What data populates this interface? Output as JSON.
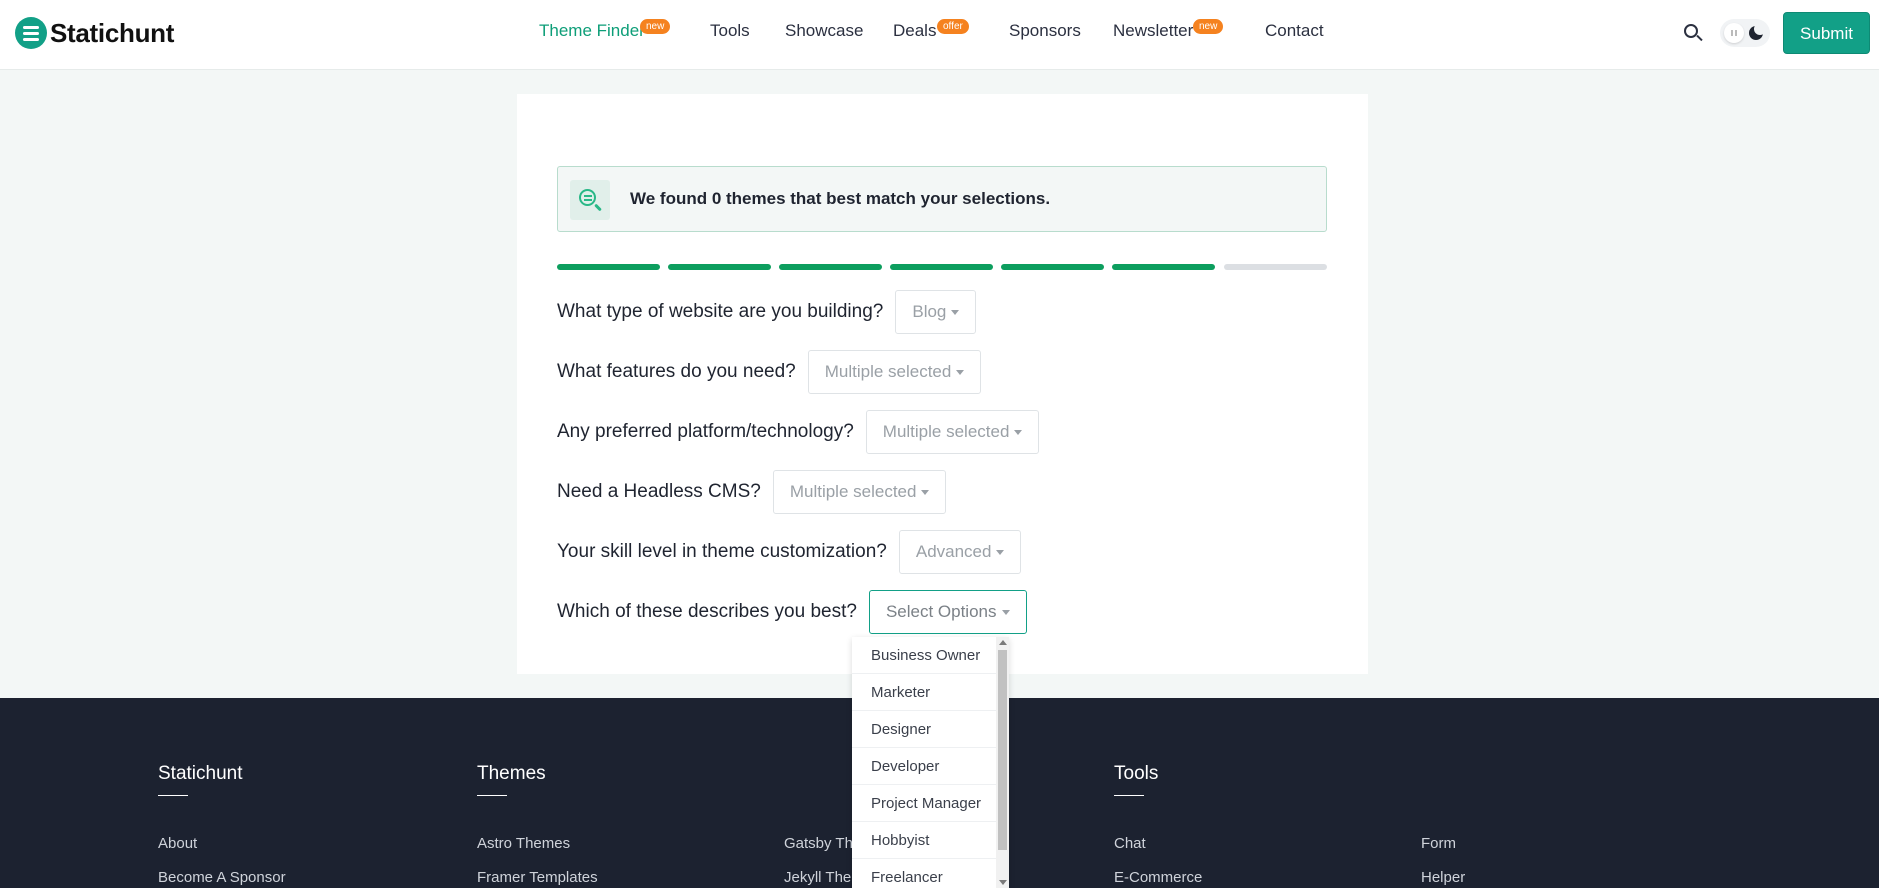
{
  "brand": {
    "name": "Statichunt",
    "accent": "#12a087"
  },
  "nav": {
    "items": [
      {
        "label": "Theme Finder",
        "badge": "new",
        "active": true
      },
      {
        "label": "Tools",
        "badge": ""
      },
      {
        "label": "Showcase",
        "badge": ""
      },
      {
        "label": "Deals",
        "badge": "offer"
      },
      {
        "label": "Sponsors",
        "badge": ""
      },
      {
        "label": "Newsletter",
        "badge": "new"
      },
      {
        "label": "Contact",
        "badge": ""
      }
    ],
    "submit_label": "Submit",
    "search_icon": "search-icon",
    "theme_toggle_icon": "moon-icon"
  },
  "finder": {
    "result_text": "We found 0 themes that best match your selections.",
    "progress": {
      "completed_steps": 6,
      "total_steps": 7,
      "done_color": "#0d9e5e",
      "todo_color": "#dcdfe3"
    },
    "questions": [
      {
        "label": "What type of website are you building?",
        "value": "Blog"
      },
      {
        "label": "What features do you need?",
        "value": "Multiple selected"
      },
      {
        "label": "Any preferred platform/technology?",
        "value": "Multiple selected"
      },
      {
        "label": "Need a Headless CMS?",
        "value": "Multiple selected"
      },
      {
        "label": "Your skill level in theme customization?",
        "value": "Advanced"
      },
      {
        "label": "Which of these describes you best?",
        "value": "Select Options"
      }
    ],
    "dropdown_options": [
      "Business Owner",
      "Marketer",
      "Designer",
      "Developer",
      "Project Manager",
      "Hobbyist",
      "Freelancer"
    ]
  },
  "footer": {
    "columns": [
      {
        "heading": "Statichunt",
        "links": [
          "About",
          "Become A Sponsor"
        ]
      },
      {
        "heading": "Themes",
        "links": [
          "Astro Themes",
          "Framer Templates"
        ]
      },
      {
        "heading": "",
        "links": [
          "Gatsby The",
          "Jekyll Them"
        ]
      },
      {
        "heading": "Tools",
        "links": [
          "Chat",
          "E-Commerce"
        ]
      },
      {
        "heading": "",
        "links": [
          "Form",
          "Helper"
        ]
      }
    ]
  }
}
